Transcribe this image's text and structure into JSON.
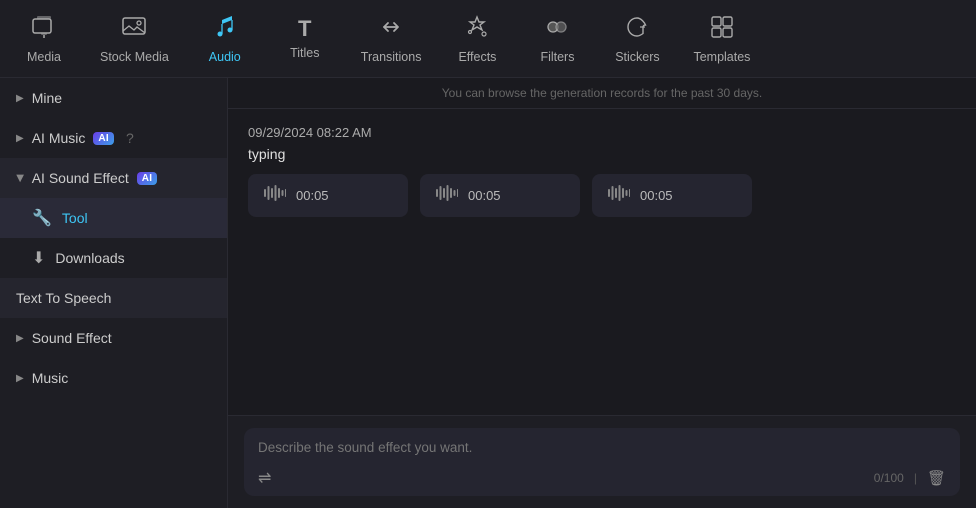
{
  "topnav": {
    "items": [
      {
        "label": "Media",
        "icon": "🎞",
        "key": "media",
        "active": false
      },
      {
        "label": "Stock Media",
        "icon": "🎬",
        "key": "stock-media",
        "active": false
      },
      {
        "label": "Audio",
        "icon": "🎵",
        "key": "audio",
        "active": true
      },
      {
        "label": "Titles",
        "icon": "T",
        "key": "titles",
        "active": false
      },
      {
        "label": "Transitions",
        "icon": "⟲",
        "key": "transitions",
        "active": false
      },
      {
        "label": "Effects",
        "icon": "✨",
        "key": "effects",
        "active": false
      },
      {
        "label": "Filters",
        "icon": "🔵",
        "key": "filters",
        "active": false
      },
      {
        "label": "Stickers",
        "icon": "🏷",
        "key": "stickers",
        "active": false
      },
      {
        "label": "Templates",
        "icon": "▦",
        "key": "templates",
        "active": false
      }
    ]
  },
  "sidebar": {
    "mine_label": "Mine",
    "ai_music_label": "AI Music",
    "ai_sound_effect_label": "AI Sound Effect",
    "tool_label": "Tool",
    "downloads_label": "Downloads",
    "text_to_speech_label": "Text To Speech",
    "sound_effect_label": "Sound Effect",
    "music_label": "Music"
  },
  "content": {
    "info_text": "You can browse the generation records for the past 30 days.",
    "record_date": "09/29/2024 08:22 AM",
    "record_keyword": "typing",
    "audio_cards": [
      {
        "duration": "00:05"
      },
      {
        "duration": "00:05"
      },
      {
        "duration": "00:05"
      }
    ]
  },
  "prompt": {
    "placeholder": "Describe the sound effect you want.",
    "char_count": "0/100"
  }
}
